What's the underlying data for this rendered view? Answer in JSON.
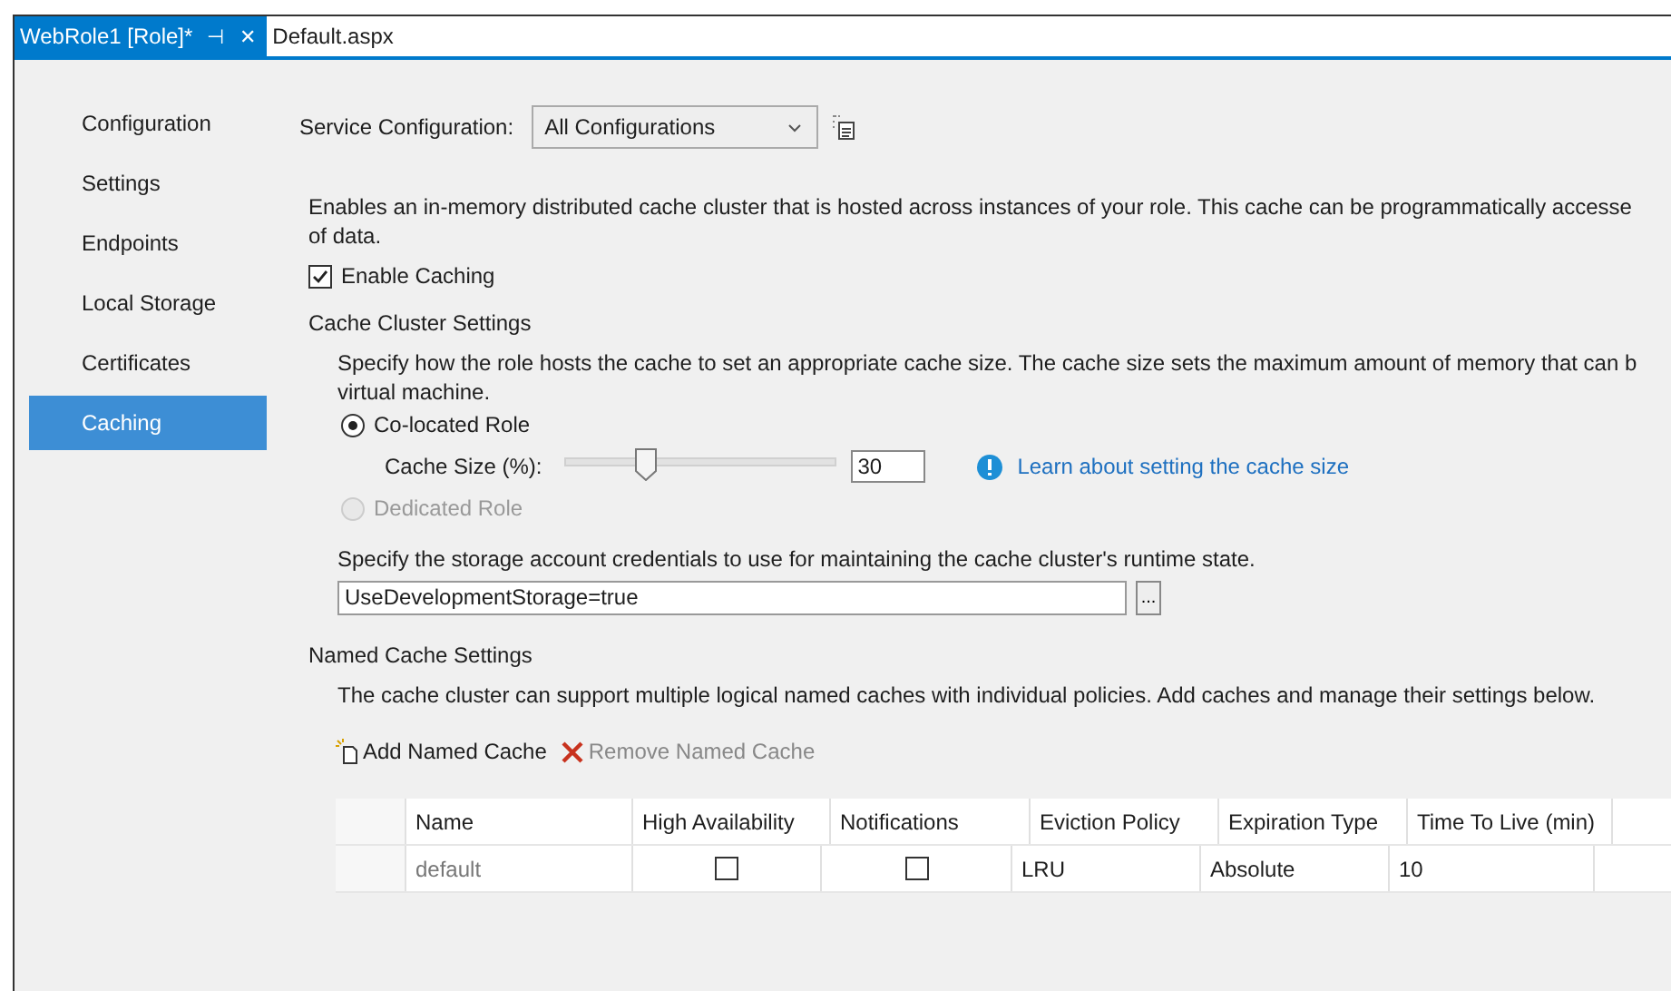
{
  "tabs": [
    {
      "label": "WebRole1 [Role]*",
      "selected": true,
      "pin": "⊣",
      "close": "✕"
    },
    {
      "label": "Default.aspx",
      "selected": false
    }
  ],
  "sidebar": {
    "items": [
      {
        "label": "Configuration",
        "selected": false
      },
      {
        "label": "Settings",
        "selected": false
      },
      {
        "label": "Endpoints",
        "selected": false
      },
      {
        "label": "Local Storage",
        "selected": false
      },
      {
        "label": "Certificates",
        "selected": false
      },
      {
        "label": "Caching",
        "selected": true
      }
    ]
  },
  "service_configuration": {
    "label": "Service Configuration:",
    "value": "All Configurations"
  },
  "intro": [
    "Enables an in-memory distributed cache cluster that is hosted across instances of your role. This cache can be programmatically accesse",
    "of data."
  ],
  "enable_caching": {
    "label": "Enable Caching",
    "checked": true
  },
  "cache_cluster": {
    "heading": "Cache Cluster Settings",
    "description": [
      "Specify how the role hosts the cache to set an appropriate cache size. The cache size sets the maximum amount of memory that can b",
      "virtual machine."
    ],
    "roles": [
      {
        "label": "Co-located Role",
        "selected": true,
        "disabled": false
      },
      {
        "label": "Dedicated Role",
        "selected": false,
        "disabled": true
      }
    ],
    "cache_size": {
      "label": "Cache Size (%):",
      "level": 0.3,
      "value": "30"
    },
    "learn_link": "Learn about setting the cache size",
    "storage_text": "Specify the storage account credentials to use for maintaining the cache cluster's runtime state.",
    "storage_value": "UseDevelopmentStorage=true",
    "browse": "..."
  },
  "named_caches": {
    "heading": "Named Cache Settings",
    "description": "The cache cluster can support multiple logical named caches with individual policies. Add caches and manage their settings below.",
    "add": {
      "label": "Add Named Cache",
      "disabled": false
    },
    "remove": {
      "label": "Remove Named Cache",
      "disabled": true
    },
    "table": {
      "columns": [
        "Name",
        "High Availability",
        "Notifications",
        "Eviction Policy",
        "Expiration Type",
        "Time To Live (min)"
      ],
      "rows": [
        {
          "name": "default",
          "high_availability": false,
          "notifications": false,
          "eviction_policy": "LRU",
          "expiration_type": "Absolute",
          "ttl": "10"
        }
      ]
    }
  }
}
